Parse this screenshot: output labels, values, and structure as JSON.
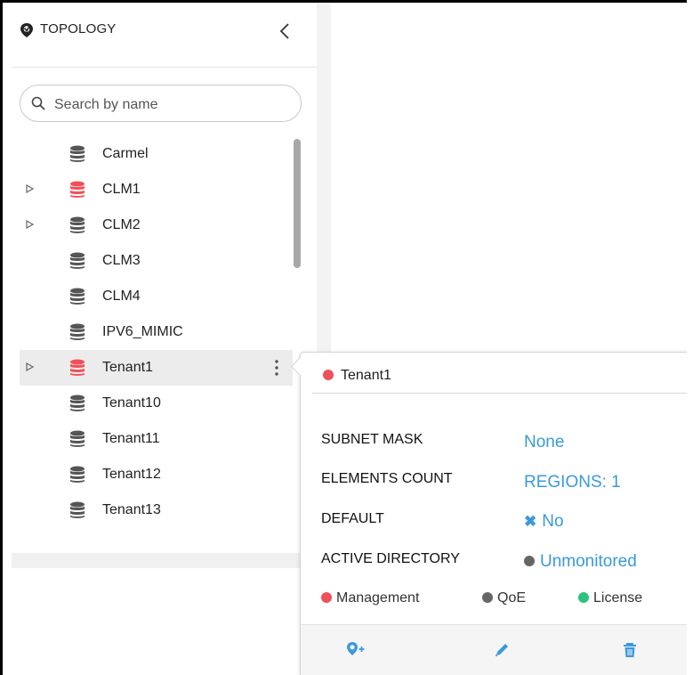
{
  "sidebar": {
    "title": "TOPOLOGY",
    "search": {
      "placeholder": "Search by name",
      "value": ""
    },
    "items": [
      {
        "label": "Carmel",
        "status": "normal",
        "expandable": false
      },
      {
        "label": "CLM1",
        "status": "error",
        "expandable": true
      },
      {
        "label": "CLM2",
        "status": "normal",
        "expandable": true
      },
      {
        "label": "CLM3",
        "status": "normal",
        "expandable": false
      },
      {
        "label": "CLM4",
        "status": "normal",
        "expandable": false
      },
      {
        "label": "IPV6_MIMIC",
        "status": "normal",
        "expandable": false
      },
      {
        "label": "Tenant1",
        "status": "error",
        "expandable": true,
        "selected": true
      },
      {
        "label": "Tenant10",
        "status": "normal",
        "expandable": false
      },
      {
        "label": "Tenant11",
        "status": "normal",
        "expandable": false
      },
      {
        "label": "Tenant12",
        "status": "normal",
        "expandable": false
      },
      {
        "label": "Tenant13",
        "status": "normal",
        "expandable": false
      }
    ]
  },
  "popover": {
    "title": "Tenant1",
    "properties": [
      {
        "label": "SUBNET MASK",
        "value": "None"
      },
      {
        "label": "ELEMENTS COUNT",
        "value": "REGIONS: 1"
      },
      {
        "label": "DEFAULT",
        "value": "No"
      },
      {
        "label": "ACTIVE DIRECTORY",
        "value": "Unmonitored"
      }
    ],
    "legend": [
      {
        "label": "Management",
        "color": "#f0505a"
      },
      {
        "label": "QoE",
        "color": "#666666"
      },
      {
        "label": "License",
        "color": "#2ec27e"
      }
    ],
    "actions": [
      {
        "icon": "add-location-icon"
      },
      {
        "icon": "pencil-icon"
      },
      {
        "icon": "trash-icon"
      }
    ]
  },
  "colors": {
    "accent": "#3a9ad9",
    "error": "#f0505a",
    "normal_icon": "#555555",
    "selected_row": "#ececec"
  }
}
